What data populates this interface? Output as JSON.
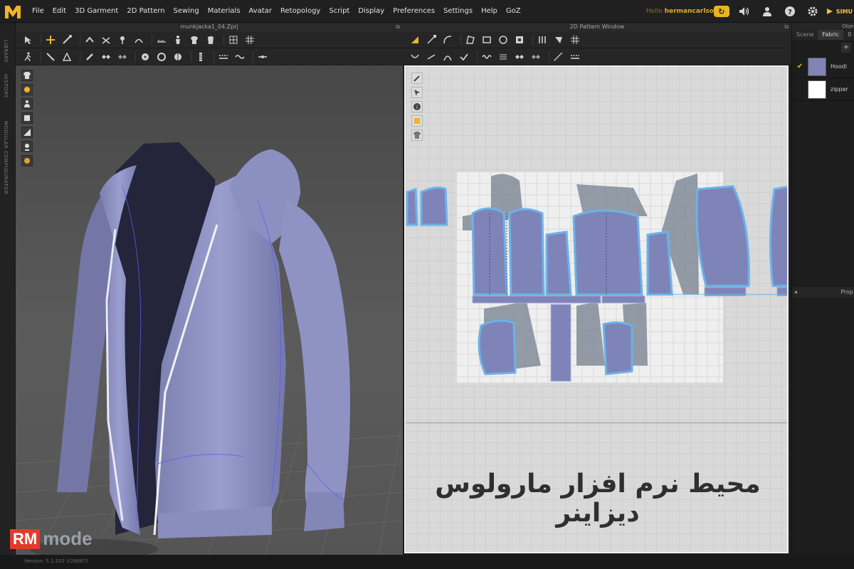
{
  "menubar": {
    "items": [
      "File",
      "Edit",
      "3D Garment",
      "2D Pattern",
      "Sewing",
      "Materials",
      "Avatar",
      "Retopology",
      "Script",
      "Display",
      "Preferences",
      "Settings",
      "Help",
      "GoZ"
    ],
    "hello_prefix": "Hello",
    "username": "hermancarlson",
    "simulation_label": "SIMU"
  },
  "left_strip": {
    "labels": [
      "LIBRARY",
      "HISTORY",
      "MODULAR CONFIGURATOR"
    ]
  },
  "window3d": {
    "title": "munkjacka1_04.Zprj"
  },
  "window2d": {
    "title": "2D Pattern Window"
  },
  "overlay_text": "محیط نرم افزار مارولوس دیزاینر",
  "right_panel": {
    "title": "Obje",
    "tabs": [
      "Scene",
      "Fabric",
      "B"
    ],
    "add_label": "+",
    "fabrics": [
      {
        "name": "Hoodi",
        "color": "#8184b4",
        "checked": true
      },
      {
        "name": "zipper",
        "color": "#ffffff",
        "checked": false
      }
    ],
    "property_label": "Prop"
  },
  "status": {
    "version": "Version: 5.1.332 (r26667)"
  },
  "watermark": {
    "rm": "RM",
    "mode": "mode"
  },
  "colors": {
    "accent": "#e0a92a",
    "garment": "#8a8fc2",
    "pattern_fill": "#7f84b8",
    "pattern_outline": "#6bb3e8"
  },
  "icons": {
    "toolbar3d_row1": [
      "select-icon",
      "move-icon",
      "transform-icon",
      "fold-icon",
      "tack-icon",
      "pin-icon",
      "measure-icon",
      "avatar-icon",
      "garment-icon"
    ],
    "toolbar2d_row1": [
      "transform-pattern-icon",
      "edit-point-icon",
      "edit-curve-icon",
      "polygon-icon",
      "rectangle-icon",
      "circle-icon",
      "sewing-icon",
      "segment-sewing-icon"
    ]
  }
}
